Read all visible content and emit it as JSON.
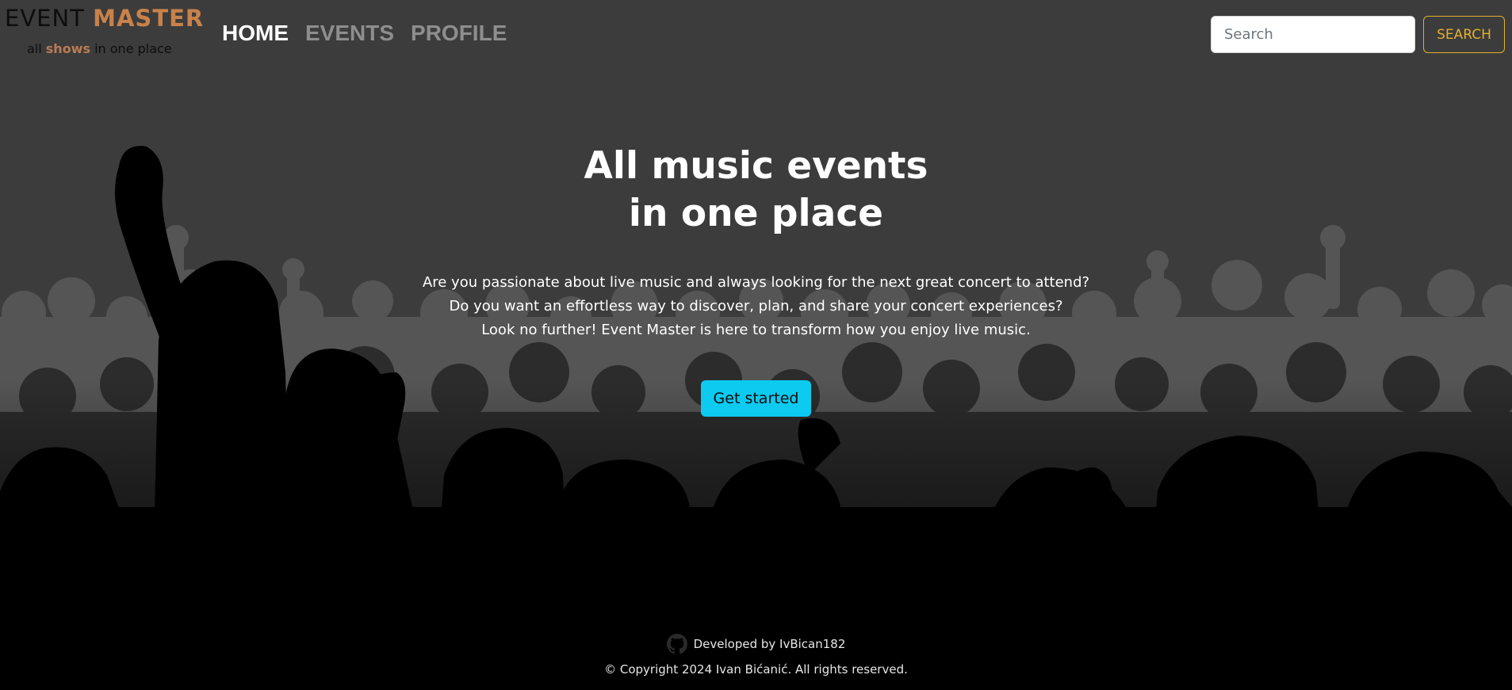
{
  "brand": {
    "name_part1": "EVENT ",
    "name_part2": "MASTER",
    "tagline_part1": "all ",
    "tagline_part2": "shows",
    "tagline_part3": " in one place",
    "accent_color": "#c8824a"
  },
  "nav": {
    "items": [
      {
        "label": "HOME",
        "active": true
      },
      {
        "label": "EVENTS",
        "active": false
      },
      {
        "label": "PROFILE",
        "active": false
      }
    ]
  },
  "search": {
    "placeholder": "Search",
    "value": "",
    "button_label": "SEARCH",
    "button_color": "#e3b02a"
  },
  "hero": {
    "title_line1": "All music events",
    "title_line2": "in one place",
    "desc_line1": "Are you passionate about live music and always looking for the next great concert to attend?",
    "desc_line2": "Do you want an effortless way to discover, plan, and share your concert experiences?",
    "desc_line3": "Look no further! Event Master is here to transform how you enjoy live music.",
    "cta_label": "Get started",
    "cta_color": "#0dcaf0"
  },
  "footer": {
    "dev_prefix": "Developed by ",
    "dev_name": "IvBican182",
    "copyright": "© Copyright 2024 Ivan Bićanić. All rights reserved.",
    "icon": "github-icon"
  }
}
